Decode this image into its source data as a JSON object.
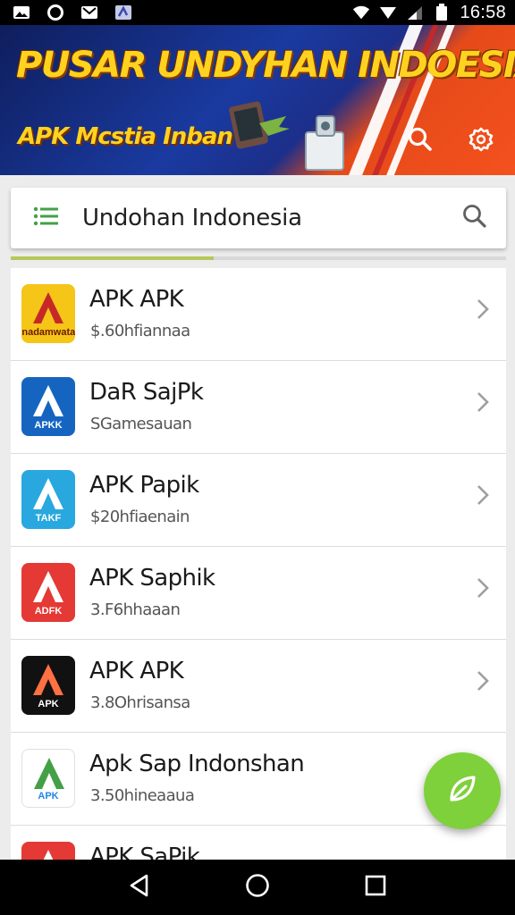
{
  "status_bar": {
    "time": "16:58",
    "left_icons": [
      "gallery-icon",
      "circle-icon",
      "mail-icon",
      "app-icon"
    ],
    "right_icons": [
      "wifi-icon",
      "signal-icon",
      "signal-bars-icon",
      "battery-icon"
    ]
  },
  "banner": {
    "title": "PUSAR UNDYHAN INDOESIA",
    "subtitle": "APK Mcstia Inban",
    "search_icon": "search-icon",
    "settings_icon": "settings-icon",
    "colors": {
      "title": "#ffd21f",
      "blue": "#1a3aa0",
      "orange": "#f4511e"
    }
  },
  "search": {
    "menu_icon": "menu-icon",
    "value": "Undohan Indonesia",
    "search_icon": "search-icon",
    "progress": 0.41
  },
  "apps": [
    {
      "title": "APK APK",
      "subtitle": "$.60hfiannaa",
      "icon_label": "Pnadamwatab",
      "icon_bg": "#f5c518",
      "icon_fg": "#6b1a00"
    },
    {
      "title": "DaR SajPk",
      "subtitle": "SGamesauan",
      "icon_label": "APKK",
      "icon_bg": "#1565c0",
      "icon_fg": "#ffffff"
    },
    {
      "title": "APK Papik",
      "subtitle": "$20hfiaenain",
      "icon_label": "TAKF",
      "icon_bg": "#29a8e0",
      "icon_fg": "#ffffff"
    },
    {
      "title": "APK Saphik",
      "subtitle": "3.F6hhaaan",
      "icon_label": "ADFK",
      "icon_bg": "#e53935",
      "icon_fg": "#ffffff"
    },
    {
      "title": "APK APK",
      "subtitle": "3.8Ohrisansa",
      "icon_label": "APK",
      "icon_bg": "#111111",
      "icon_fg": "#ffffff"
    },
    {
      "title": "Apk Sap Indonshan",
      "subtitle": "3.50hineaaua",
      "icon_label": "APK",
      "icon_bg": "#ffffff",
      "icon_fg": "#1e88e5"
    },
    {
      "title": "APK SaPik",
      "subtitle": "",
      "icon_label": "",
      "icon_bg": "#e53935",
      "icon_fg": "#ffffff"
    }
  ],
  "fab": {
    "icon": "leaf-icon",
    "color": "#7ed13a"
  },
  "nav": {
    "back_icon": "back-icon",
    "home_icon": "home-icon",
    "recents_icon": "recents-icon"
  }
}
